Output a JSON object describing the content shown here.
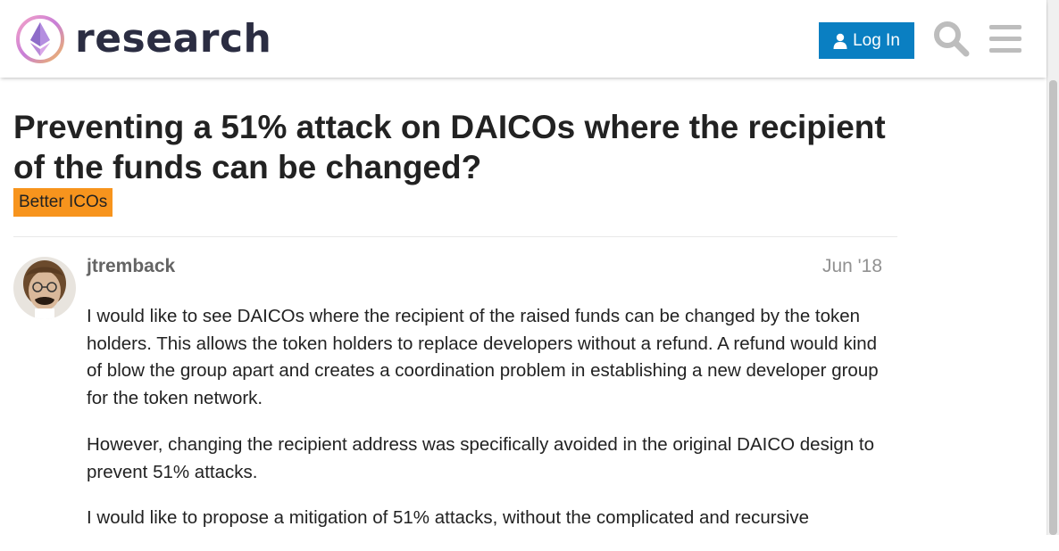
{
  "header": {
    "logo_text": "research",
    "login_label": "Log In",
    "search_icon": "search-icon",
    "menu_icon": "hamburger-menu-icon",
    "accent_color": "#0a7fc2"
  },
  "topic": {
    "title": "Preventing a 51% attack on DAICOs where the recipient of the funds can be changed?",
    "category": "Better ICOs",
    "category_color": "#f7941d"
  },
  "post": {
    "username": "jtremback",
    "date": "Jun '18",
    "paragraphs": [
      "I would like to see DAICOs where the recipient of the raised funds can be changed by the token holders. This allows the token holders to replace developers without a refund. A refund would kind of blow the group apart and creates a coordination problem in establishing a new developer group for the token network.",
      "However, changing the recipient address was specifically avoided in the original DAICO design to prevent 51% attacks.",
      "I would like to propose a mitigation of 51% attacks, without the complicated and recursive"
    ]
  }
}
